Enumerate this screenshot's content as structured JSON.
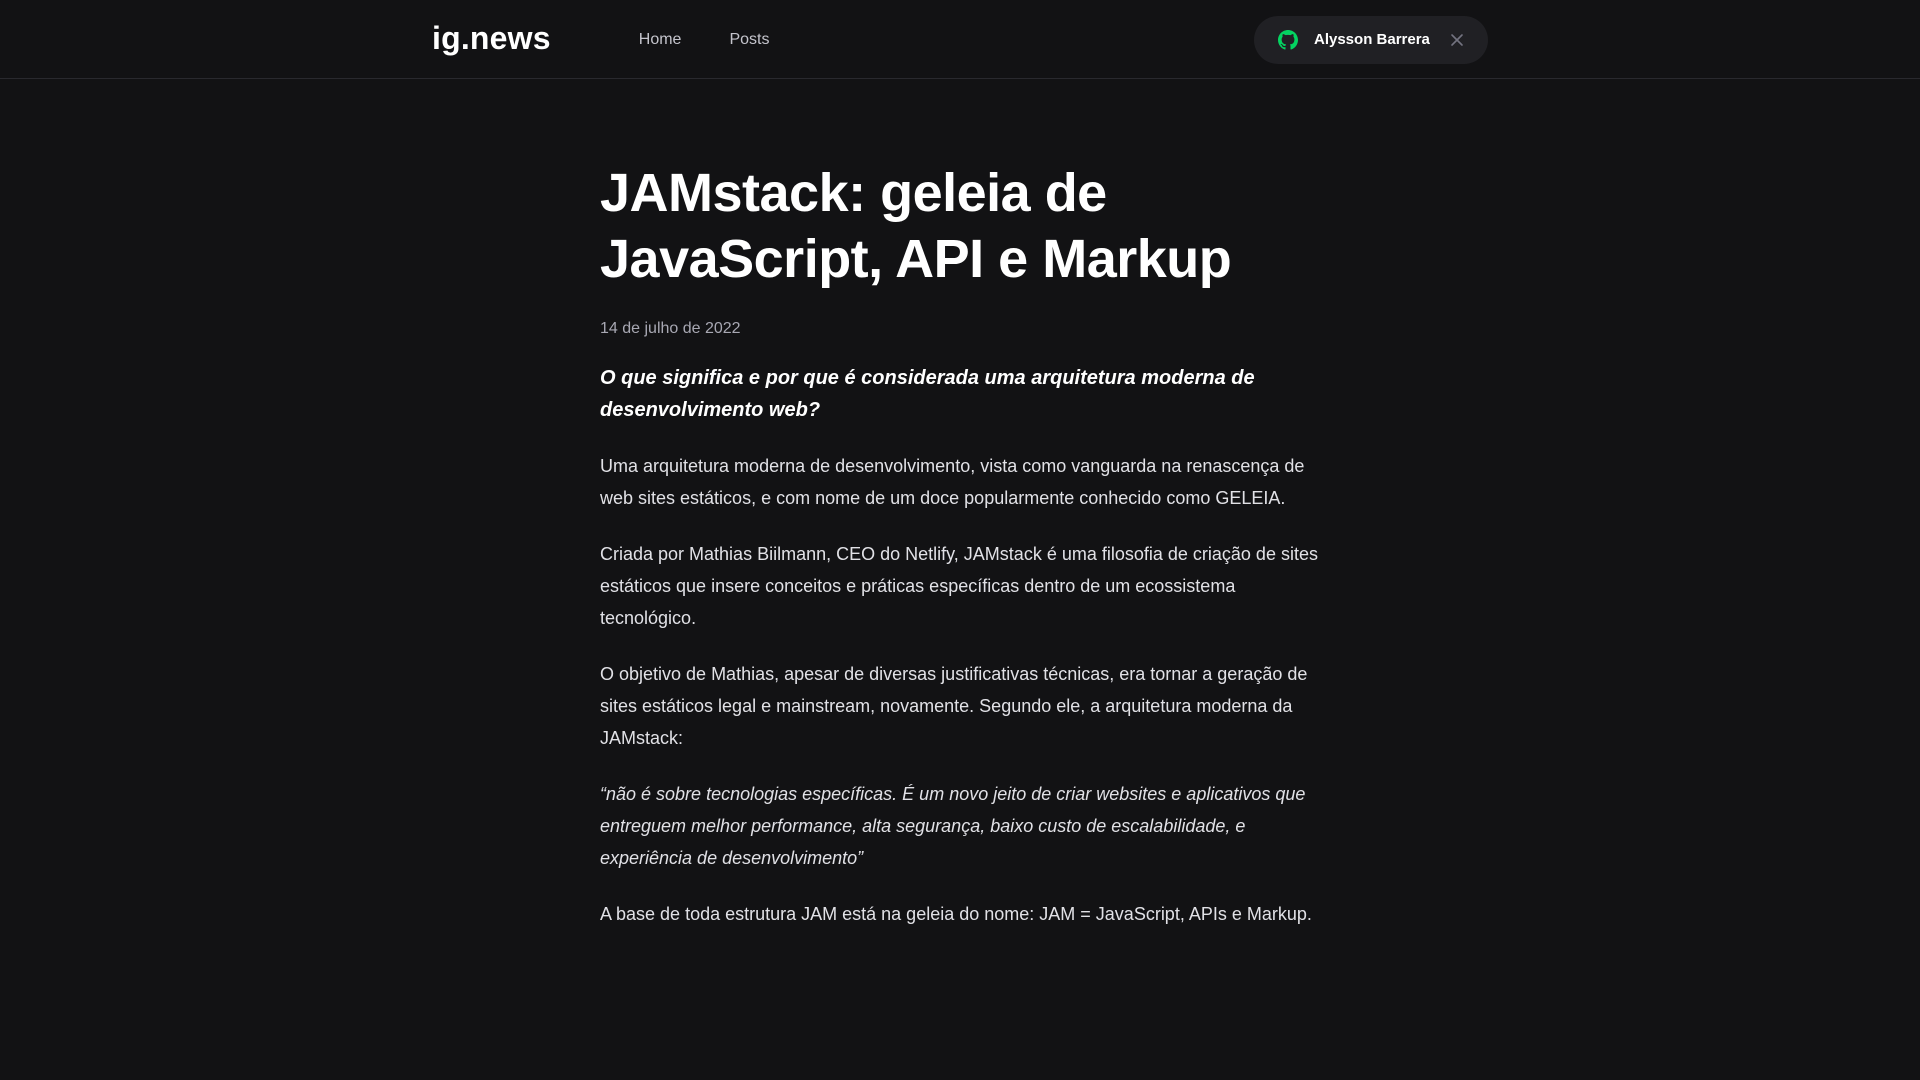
{
  "header": {
    "logo": "ig.news",
    "nav": [
      {
        "label": "Home"
      },
      {
        "label": "Posts"
      }
    ],
    "user": {
      "name": "Alysson Barrera",
      "icon": "github-icon",
      "close_icon": "close-icon",
      "icon_color": "#04d361"
    }
  },
  "article": {
    "title": "JAMstack: geleia de JavaScript, API e Markup",
    "date": "14 de julho de 2022",
    "lead": "O que significa e por que é considerada uma arquitetura moderna de desenvolvimento web?",
    "paragraphs": [
      "Uma arquitetura moderna de desenvolvimento, vista como vanguarda na renascença de web sites estáticos, e com nome de um doce popularmente conhecido como GELEIA.",
      "Criada por Mathias Biilmann, CEO do Netlify, JAMstack é uma filosofia de criação de sites estáticos que insere conceitos e práticas específicas dentro de um ecossistema tecnológico.",
      "O objetivo de Mathias, apesar de diversas justificativas técnicas, era tornar a geração de sites estáticos legal e mainstream, novamente. Segundo ele, a arquitetura moderna da JAMstack:"
    ],
    "quote": "“não é sobre tecnologias específicas. É um novo jeito de criar websites e aplicativos que entreguem melhor performance, alta segurança, baixo custo de escalabilidade, e experiência de desenvolvimento”",
    "closing": "A base de toda estrutura JAM está na geleia do nome: JAM = JavaScript, APIs e Markup."
  },
  "colors": {
    "background": "#121214",
    "header_border": "#29292e",
    "accent": "#04d361"
  }
}
